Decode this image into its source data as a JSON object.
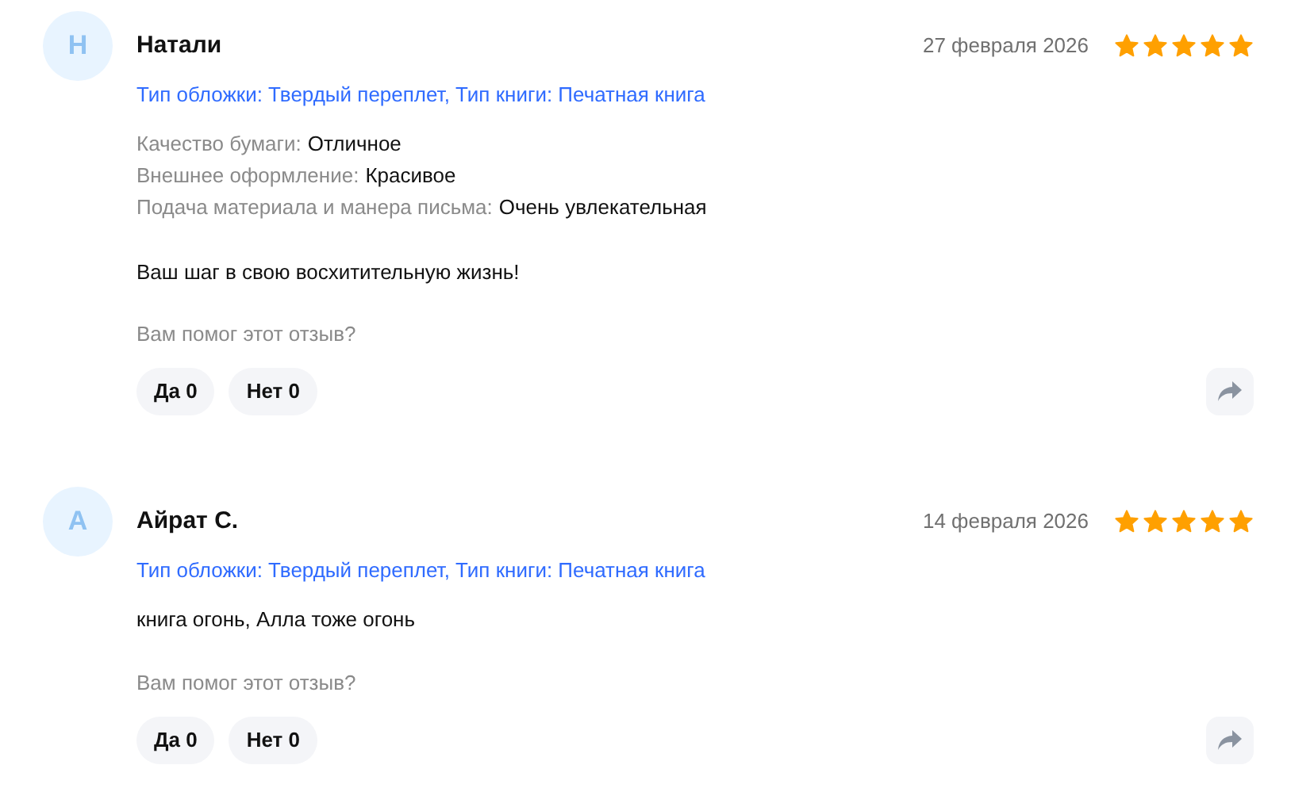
{
  "reviews": [
    {
      "avatar_letter": "Н",
      "name": "Натали",
      "date": "27 февраля 2026",
      "stars": 5,
      "variant": "Тип обложки: Твердый переплет, Тип книги: Печатная книга",
      "attributes": [
        {
          "label": "Качество бумаги:",
          "value": "Отличное"
        },
        {
          "label": "Внешнее оформление:",
          "value": "Красивое"
        },
        {
          "label": "Подача материала и манера письма:",
          "value": "Очень увлекательная"
        }
      ],
      "text": "Ваш шаг в свою восхитительную жизнь!",
      "helpful_question": "Вам помог этот отзыв?",
      "votes": [
        "Да 0",
        "Нет 0"
      ]
    },
    {
      "avatar_letter": "А",
      "name": "Айрат С.",
      "date": "14 февраля 2026",
      "stars": 5,
      "variant": "Тип обложки: Твердый переплет, Тип книги: Печатная книга",
      "text": "книга огонь, Алла тоже огонь",
      "helpful_question": "Вам помог этот отзыв?",
      "votes": [
        "Да 0",
        "Нет 0"
      ]
    }
  ]
}
